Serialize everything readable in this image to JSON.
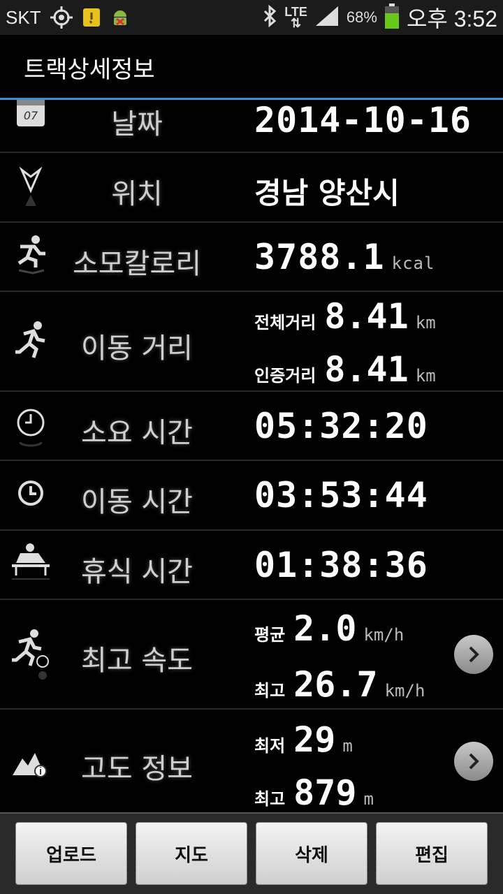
{
  "status_bar": {
    "carrier": "SKT",
    "network": "LTE",
    "battery": "68%",
    "time": "오후 3:52",
    "icons": [
      "gps-icon",
      "notification-icon",
      "android-debug-icon",
      "bluetooth-icon",
      "lte-icon",
      "signal-icon",
      "battery-icon"
    ]
  },
  "header": {
    "title": "트랙상세정보"
  },
  "rows": {
    "date": {
      "label": "날짜",
      "value": "2014-10-16",
      "icon": "calendar-icon",
      "icon_text": "07"
    },
    "location": {
      "label": "위치",
      "value": "경남 양산시",
      "icon": "location-arrow-icon"
    },
    "calories": {
      "label": "소모칼로리",
      "value": "3788.1",
      "unit": "kcal",
      "icon": "running-man-icon"
    },
    "distance": {
      "label": "이동 거리",
      "icon": "runner-icon",
      "total_label": "전체거리",
      "total_value": "8.41",
      "total_unit": "km",
      "cert_label": "인증거리",
      "cert_value": "8.41",
      "cert_unit": "km"
    },
    "elapsed": {
      "label": "소요 시간",
      "value": "05:32:20",
      "icon": "stopwatch-icon"
    },
    "moving": {
      "label": "이동 시간",
      "value": "03:53:44",
      "icon": "clock-icon"
    },
    "rest": {
      "label": "휴식 시간",
      "value": "01:38:36",
      "icon": "resting-icon"
    },
    "speed": {
      "label": "최고 속도",
      "icon": "speed-runner-icon",
      "avg_label": "평균",
      "avg_value": "2.0",
      "avg_unit": "km/h",
      "max_label": "최고",
      "max_value": "26.7",
      "max_unit": "km/h"
    },
    "altitude": {
      "label": "고도 정보",
      "icon": "mountain-info-icon",
      "min_label": "최저",
      "min_value": "29",
      "min_unit": "m",
      "max_label": "최고",
      "max_value": "879",
      "max_unit": "m"
    }
  },
  "bottom_bar": {
    "upload": "업로드",
    "map": "지도",
    "delete": "삭제",
    "edit": "편집"
  },
  "colors": {
    "accent": "#3b8fd0",
    "background": "#000000"
  }
}
